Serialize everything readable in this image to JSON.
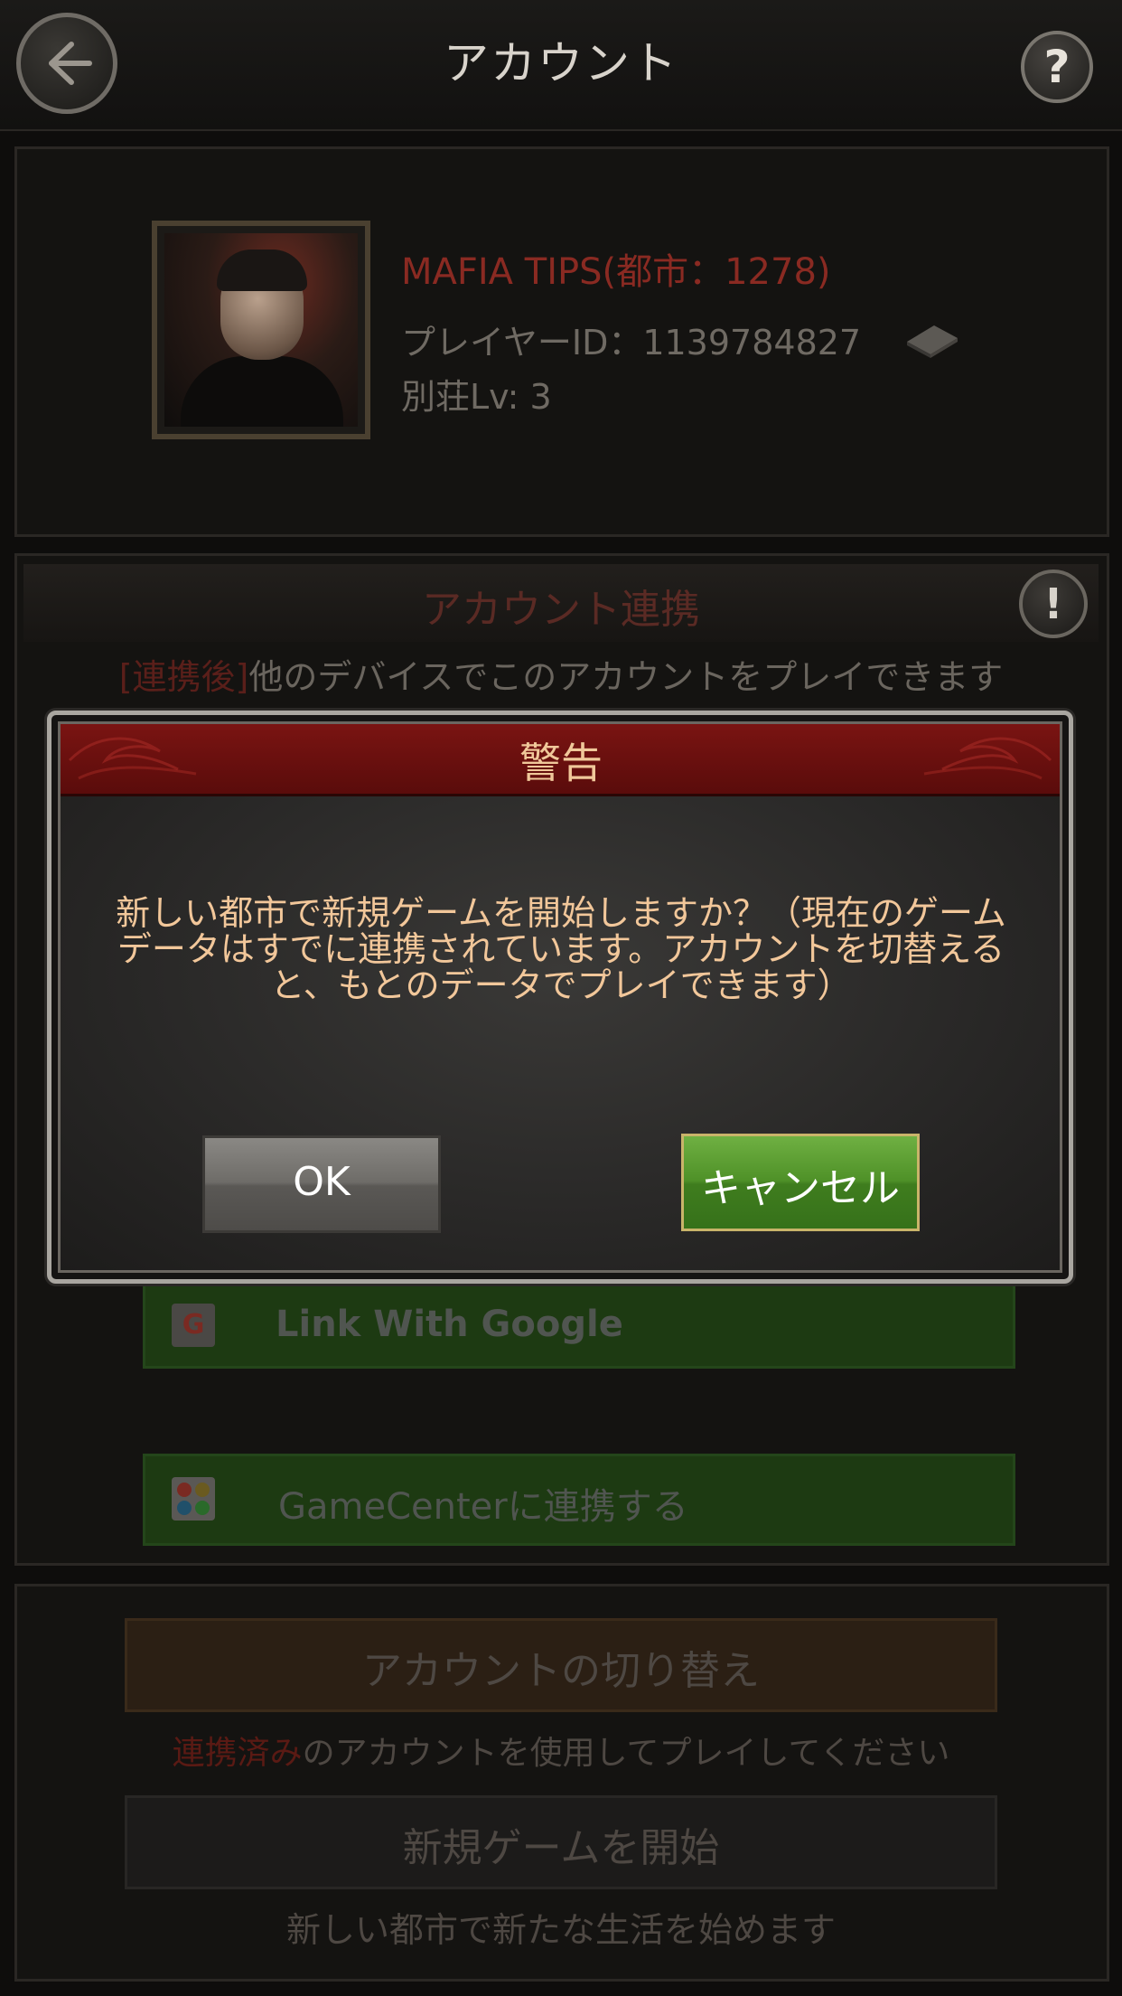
{
  "header": {
    "title": "アカウント",
    "help_label": "?"
  },
  "profile": {
    "name": "MAFIA TIPS(都市：1278)",
    "player_id": "プレイヤーID：1139784827",
    "level": "別荘Lv: 3"
  },
  "link_section": {
    "title": "アカウント連携",
    "info_label": "!",
    "note_highlight": "[連携後]",
    "note_rest": "他のデバイスでこのアカウントをプレイできます",
    "google_icon_letter": "G",
    "google_button": "Link With Google",
    "gamecenter_button": "GameCenterに連携する"
  },
  "bottom_section": {
    "switch_button": "アカウントの切り替え",
    "switch_note_highlight": "連携済み",
    "switch_note_rest": "のアカウントを使用してプレイしてください",
    "new_game_button": "新規ゲームを開始",
    "new_game_note": "新しい都市で新たな生活を始めます"
  },
  "dialog": {
    "title": "警告",
    "message": "新しい都市で新規ゲームを開始しますか？（現在のゲームデータはすでに連携されています。アカウントを切替えると、もとのデータでプレイできます）",
    "ok_button": "OK",
    "cancel_button": "キャンセル"
  },
  "colors": {
    "dialog_header": "#6a0f0e",
    "dialog_text": "#f2c79a",
    "cancel_button": "#4f9128",
    "ok_button": "#6e6c68",
    "player_name": "#8a2a22"
  },
  "icons": {
    "back": "back-arrow-icon",
    "help": "help-icon",
    "copy": "copy-icon",
    "info": "info-icon",
    "google": "google-icon",
    "gamecenter": "gamecenter-icon"
  }
}
